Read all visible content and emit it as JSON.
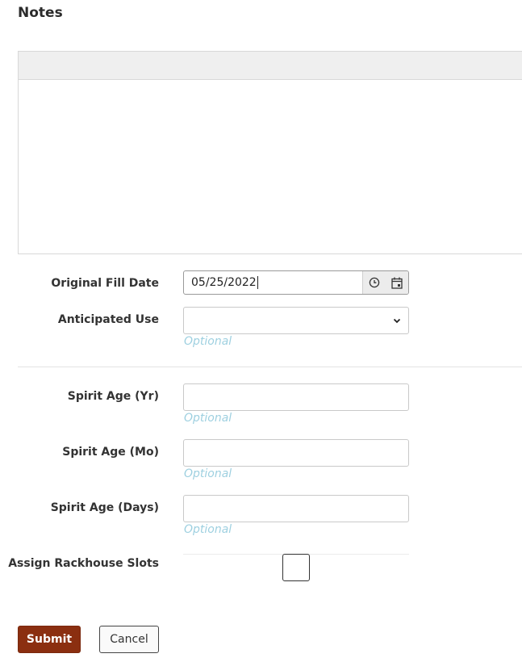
{
  "notes": {
    "title": "Notes"
  },
  "fields": {
    "original_fill_date": {
      "label": "Original Fill Date",
      "value": "05/25/2022",
      "clock_icon": "clock-icon",
      "calendar_icon": "calendar-icon"
    },
    "anticipated_use": {
      "label": "Anticipated Use",
      "value": "",
      "hint": "Optional"
    },
    "spirit_age_yr": {
      "label": "Spirit Age (Yr)",
      "value": "",
      "hint": "Optional"
    },
    "spirit_age_mo": {
      "label": "Spirit Age (Mo)",
      "value": "",
      "hint": "Optional"
    },
    "spirit_age_days": {
      "label": "Spirit Age (Days)",
      "value": "",
      "hint": "Optional"
    },
    "assign_rackhouse_slots": {
      "label": "Assign Rackhouse Slots",
      "checked": false
    }
  },
  "actions": {
    "submit": "Submit",
    "cancel": "Cancel"
  },
  "colors": {
    "submit_bg": "#8b2f10",
    "hint": "#9ed0e0"
  }
}
